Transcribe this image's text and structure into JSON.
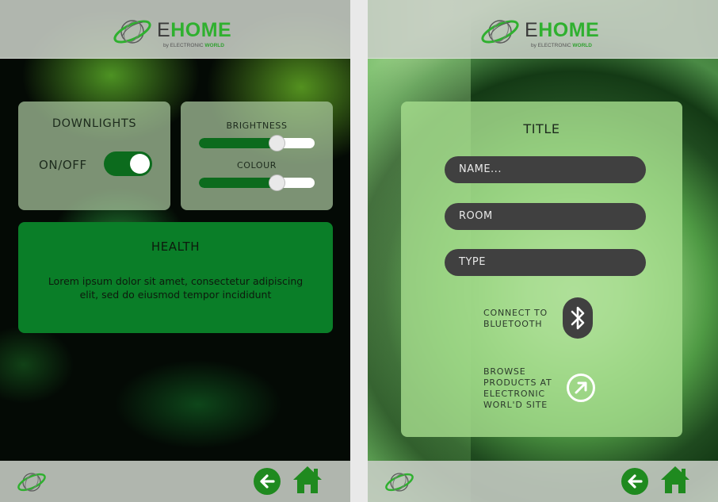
{
  "colors": {
    "accent_green": "#2fb02f",
    "dark_green": "#0c6b1d",
    "health_green": "#0a7e28",
    "field_dark": "#404040"
  },
  "brand": {
    "logo_e": "E",
    "logo_home": "HOME",
    "logo_sub_by": "by ELECTRONIC ",
    "logo_sub_world": "WORLD"
  },
  "left_screen": {
    "downlights": {
      "title": "DOWNLIGHTS",
      "toggle_label": "ON/OFF",
      "toggle_on": true
    },
    "sliders": {
      "brightness_label": "BRIGHTNESS",
      "brightness_value": 0.67,
      "colour_label": "COLOUR",
      "colour_value": 0.67
    },
    "health": {
      "title": "HEALTH",
      "text": "Lorem ipsum dolor sit amet, consectetur adipiscing elit, sed do eiusmod tempor incididunt"
    }
  },
  "right_screen": {
    "title": "TITLE",
    "name_placeholder": "NAME...",
    "room_placeholder": "ROOM",
    "type_placeholder": "TYPE",
    "bluetooth_label": "CONNECT TO BLUETOOTH",
    "browse_label": "BROWSE PRODUCTS AT ELECTRONIC WORL'D SITE"
  },
  "footer": {
    "back_icon": "arrow-left-circle-icon",
    "home_icon": "home-icon"
  }
}
